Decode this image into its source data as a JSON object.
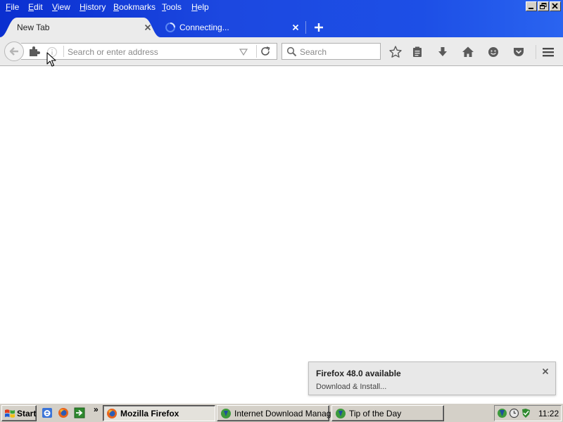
{
  "menu": {
    "file": {
      "acc": "F",
      "rest": "ile"
    },
    "edit": {
      "acc": "E",
      "rest": "dit"
    },
    "view": {
      "acc": "V",
      "rest": "iew"
    },
    "history": {
      "acc": "H",
      "rest": "istory"
    },
    "bookmarks": {
      "acc": "B",
      "rest": "ookmarks"
    },
    "tools": {
      "acc": "T",
      "rest": "ools"
    },
    "help": {
      "acc": "H",
      "rest": "elp"
    }
  },
  "tabs": [
    {
      "label": "New Tab",
      "active": true
    },
    {
      "label": "Connecting...",
      "active": false,
      "loading": true
    }
  ],
  "toolbar": {
    "url_placeholder": "Search or enter address",
    "url_value": "",
    "search_placeholder": "Search"
  },
  "notification": {
    "title": "Firefox 48.0 available",
    "action": "Download & Install..."
  },
  "taskbar": {
    "start_label": "Start",
    "chevron": "»",
    "tasks": [
      {
        "label": "Mozilla Firefox",
        "active": true
      },
      {
        "label": "Internet Download Manag...",
        "active": false
      },
      {
        "label": "Tip of the Day",
        "active": false
      }
    ],
    "clock": "11:22"
  },
  "colors": {
    "title_gradient_start": "#0a2fd0",
    "title_gradient_end": "#2a64f0",
    "toolbar_bg": "#ebebeb",
    "taskbar_bg": "#d4d0c8"
  },
  "icons": {
    "back": "back-arrow-icon",
    "identity": "puzzle-icon",
    "reload": "reload-icon",
    "search": "magnifier-icon",
    "bookmark": "star-icon",
    "reading_list": "clipboard-icon",
    "downloads": "download-arrow-icon",
    "home": "home-icon",
    "hello": "chat-bubble-icon",
    "pocket": "pocket-icon",
    "menu": "hamburger-icon"
  }
}
